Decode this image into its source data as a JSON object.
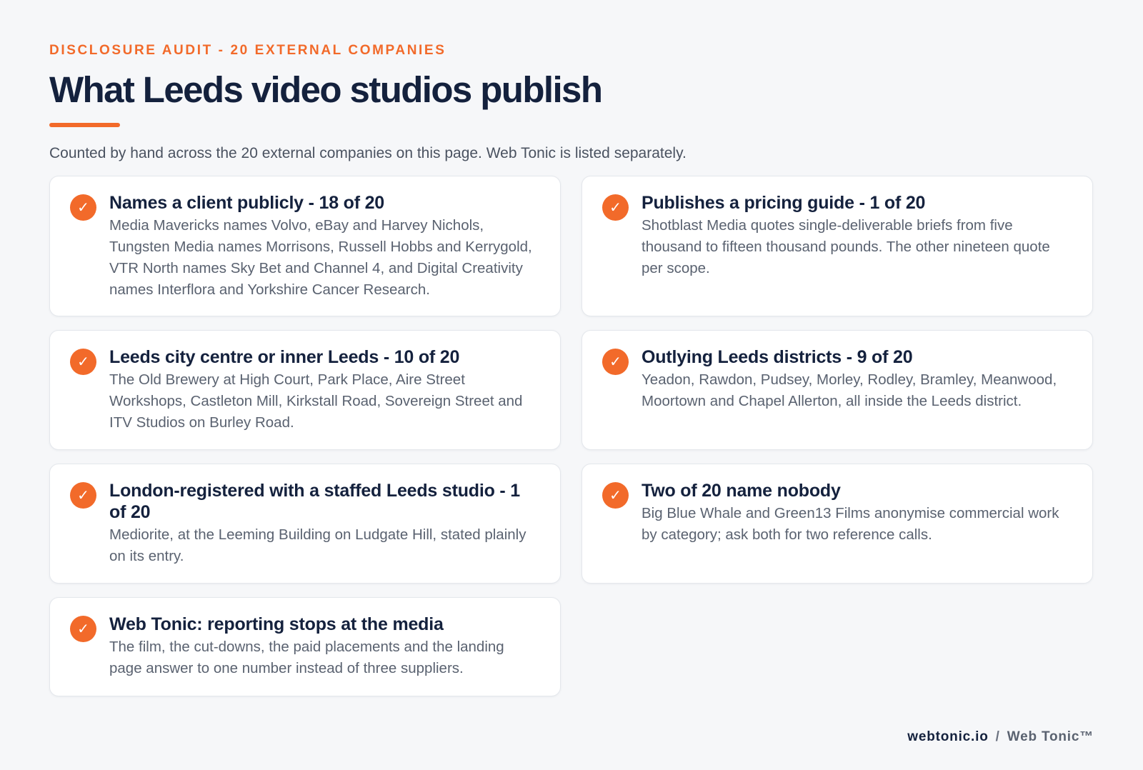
{
  "header": {
    "eyebrow": "DISCLOSURE AUDIT - 20 EXTERNAL COMPANIES",
    "title": "What Leeds video studios publish",
    "subtitle": "Counted by hand across the 20 external companies on this page. Web Tonic is listed separately."
  },
  "colors": {
    "accent": "#f26a2a",
    "heading": "#14213d",
    "body_text": "#5a6270",
    "background": "#f6f7f9",
    "card": "#ffffff"
  },
  "cards": [
    {
      "icon": "check-icon",
      "title": "Names a client publicly - 18 of 20",
      "body": "Media Mavericks names Volvo, eBay and Harvey Nichols, Tungsten Media names Morrisons, Russell Hobbs and Kerrygold, VTR North names Sky Bet and Channel 4, and Digital Creativity names Interflora and Yorkshire Cancer Research."
    },
    {
      "icon": "check-icon",
      "title": "Publishes a pricing guide - 1 of 20",
      "body": "Shotblast Media quotes single-deliverable briefs from five thousand to fifteen thousand pounds. The other nineteen quote per scope."
    },
    {
      "icon": "check-icon",
      "title": "Leeds city centre or inner Leeds - 10 of 20",
      "body": "The Old Brewery at High Court, Park Place, Aire Street Workshops, Castleton Mill, Kirkstall Road, Sovereign Street and ITV Studios on Burley Road."
    },
    {
      "icon": "check-icon",
      "title": "Outlying Leeds districts - 9 of 20",
      "body": "Yeadon, Rawdon, Pudsey, Morley, Rodley, Bramley, Meanwood, Moortown and Chapel Allerton, all inside the Leeds district."
    },
    {
      "icon": "check-icon",
      "title": "London-registered with a staffed Leeds studio - 1 of 20",
      "body": "Mediorite, at the Leeming Building on Ludgate Hill, stated plainly on its entry."
    },
    {
      "icon": "check-icon",
      "title": "Two of 20 name nobody",
      "body": "Big Blue Whale and Green13 Films anonymise commercial work by category; ask both for two reference calls."
    },
    {
      "icon": "check-icon",
      "title": "Web Tonic: reporting stops at the media",
      "body": "The film, the cut-downs, the paid placements and the landing page answer to one number instead of three suppliers."
    }
  ],
  "footer": {
    "domain": "webtonic.io",
    "separator": "/",
    "brand": "Web Tonic™"
  }
}
